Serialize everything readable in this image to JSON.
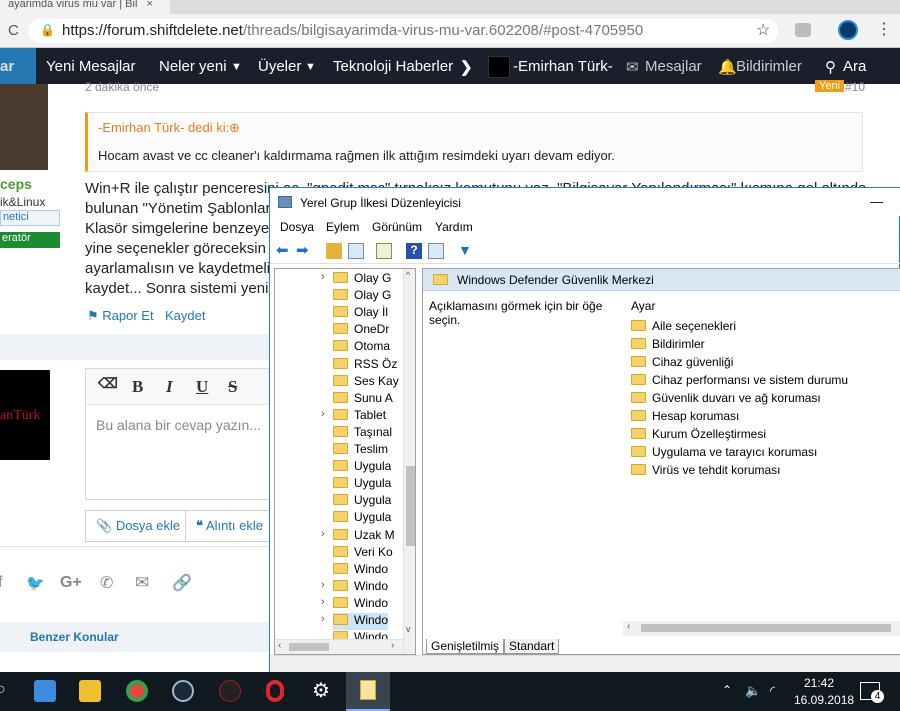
{
  "browser": {
    "tab_title": "ayarimda virus mu var | Bil",
    "url_host": "https://forum.shiftdelete.net",
    "url_path": "/threads/bilgisayarimda-virus-mu-var.602208/#post-4705950"
  },
  "site_nav": {
    "left_cut": "ar",
    "items": [
      "Yeni Mesajlar",
      "Neler yeni",
      "Üyeler",
      "Teknoloji Haberleri"
    ],
    "user": "-Emirhan Türk-",
    "messages": "Mesajlar",
    "alerts": "Bildirimler",
    "search": "Ara"
  },
  "post": {
    "time": "2 dakika önce",
    "badge": "Yeni",
    "number": "#10",
    "user_name": "ceps",
    "user_sub": "ik&Linux",
    "user_role1": "netici",
    "user_role2": "eratör",
    "quote_title": "-Emirhan Türk- dedi ki:",
    "quote_body": "Hocam avast ve cc cleaner'ı kaldırmama rağmen ilk attığım resimdeki uyarı devam ediyor.",
    "lines": [
      "Win+R ile çalıştır penceresini aç, \"gpedit.msc\" tırnaksız komutunu yaz. \"Bilgisayar Yapılandırması\" kısmına gel altında",
      "bulunan \"Yönetim Şablonları\"",
      "Klasör simgelerine benzeyen",
      "yine seçenekler göreceksin ve",
      "ayarlamalısın ve kaydetmelisin",
      "kaydet... Sonra sistemi yenide"
    ],
    "report": "Rapor Et",
    "bookmark": "Kaydet"
  },
  "reply": {
    "avatar_text": "anTürk",
    "placeholder": "Bu alana bir cevap yazın...",
    "attach": "Dosya ekle",
    "quote": "Alıntı ekle"
  },
  "similar": "Benzer Konular",
  "gpedit": {
    "title": "Yerel Grup İlkesi Düzenleyicisi",
    "minimize": "—",
    "menu": [
      "Dosya",
      "Eylem",
      "Görünüm",
      "Yardım"
    ],
    "tree": [
      "Olay G",
      "Olay G",
      "Olay İl",
      "OneDr",
      "Otoma",
      "RSS Öz",
      "Ses Kay",
      "Sunu A",
      "Tablet",
      "Taşınal",
      "Teslim",
      "Uygula",
      "Uygula",
      "Uygula",
      "Uygula",
      "Uzak M",
      "Veri Ko",
      "Windo",
      "Windo",
      "Windo",
      "Windo",
      "Windo"
    ],
    "header": "Windows Defender Güvenlik Merkezi",
    "desc": "Açıklamasını görmek için bir öğe seçin.",
    "col": "Ayar",
    "items": [
      "Aile seçenekleri",
      "Bildirimler",
      "Cihaz güvenliği",
      "Cihaz performansı ve sistem durumu",
      "Güvenlik duvarı ve ağ koruması",
      "Hesap koruması",
      "Kurum Özelleştirmesi",
      "Uygulama ve tarayıcı koruması",
      "Virüs ve tehdit koruması"
    ],
    "tab_ext": "Genişletilmiş",
    "tab_std": "Standart"
  },
  "taskbar": {
    "time": "21:42",
    "date": "16.09.2018",
    "notif": "4"
  }
}
